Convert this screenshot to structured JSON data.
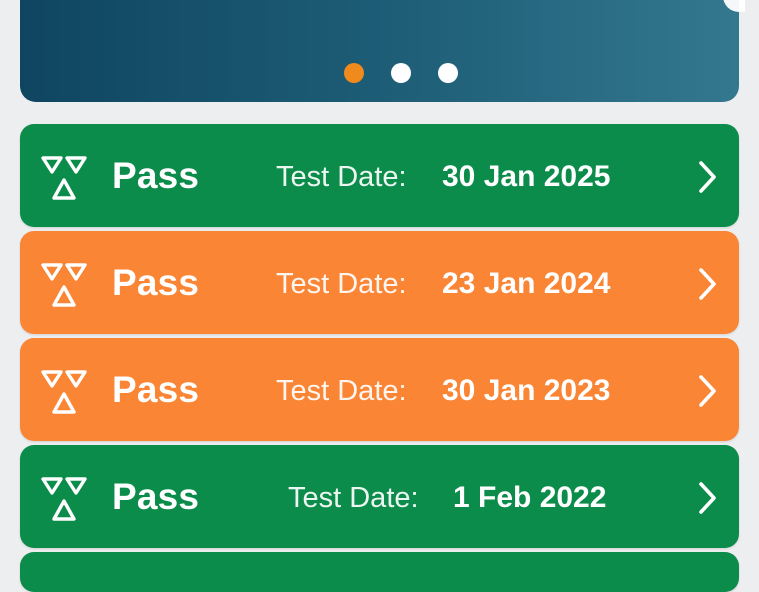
{
  "carousel": {
    "dots": [
      {
        "active": true
      },
      {
        "active": false
      },
      {
        "active": false
      }
    ]
  },
  "colors": {
    "pass_green": "#0b8c4a",
    "advisory_orange": "#f98535",
    "dot_active": "#f08a1c",
    "banner_gradient_start": "#0f4560",
    "banner_gradient_end": "#33788f"
  },
  "icons": {
    "mot": "mot-triangles-icon",
    "chevron": "chevron-right-icon"
  },
  "results": [
    {
      "status": "Pass",
      "date_label": "Test Date:",
      "date": "30 Jan 2025",
      "color": "green"
    },
    {
      "status": "Pass",
      "date_label": "Test Date:",
      "date": "23 Jan 2024",
      "color": "orange"
    },
    {
      "status": "Pass",
      "date_label": "Test Date:",
      "date": "30 Jan 2023",
      "color": "orange"
    },
    {
      "status": "Pass",
      "date_label": "Test Date:",
      "date": "1 Feb 2022",
      "color": "green"
    }
  ]
}
